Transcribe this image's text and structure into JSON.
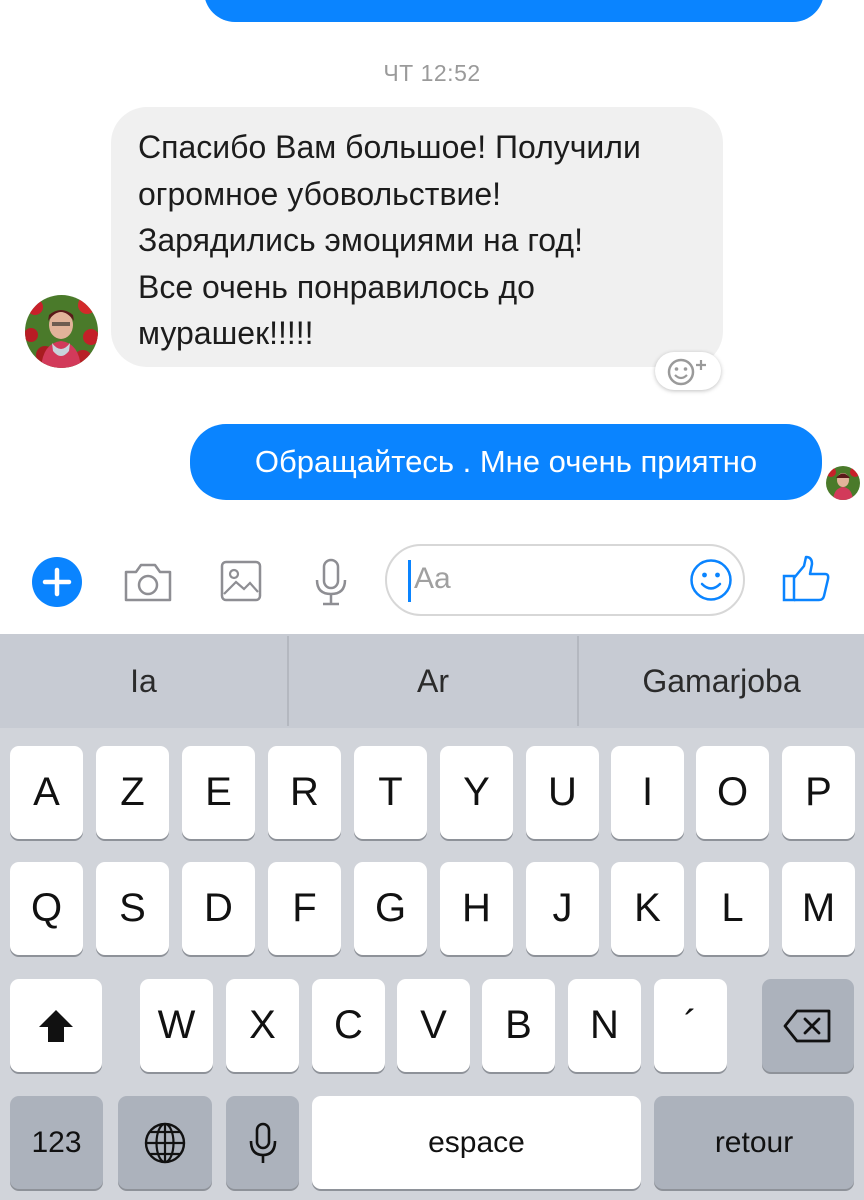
{
  "chat": {
    "timestamp": "ЧТ 12:52",
    "incoming_message": "Спасибо Вам большое! Получили\nогромное убовольствие!\nЗарядились эмоциями  на год!\nВсе очень понравилось до\nмурашек!!!!!",
    "outgoing_message": "Обращайтесь . Мне очень приятно",
    "reaction_icon": "add-reaction-icon"
  },
  "composer": {
    "placeholder": "Aa",
    "icons": [
      "plus-icon",
      "camera-icon",
      "image-icon",
      "microphone-icon",
      "emoji-icon",
      "thumbs-up-icon"
    ]
  },
  "keyboard": {
    "suggestions": [
      "Ia",
      "Ar",
      "Gamarjoba"
    ],
    "row1": [
      "A",
      "Z",
      "E",
      "R",
      "T",
      "Y",
      "U",
      "I",
      "O",
      "P"
    ],
    "row2": [
      "Q",
      "S",
      "D",
      "F",
      "G",
      "H",
      "J",
      "K",
      "L",
      "M"
    ],
    "row3": [
      "W",
      "X",
      "C",
      "V",
      "B",
      "N",
      "´"
    ],
    "numbers_label": "123",
    "space_label": "espace",
    "return_label": "retour"
  },
  "colors": {
    "accent": "#0a84ff",
    "incoming_bubble": "#f0f0f0",
    "keyboard_bg": "#d1d4da"
  }
}
